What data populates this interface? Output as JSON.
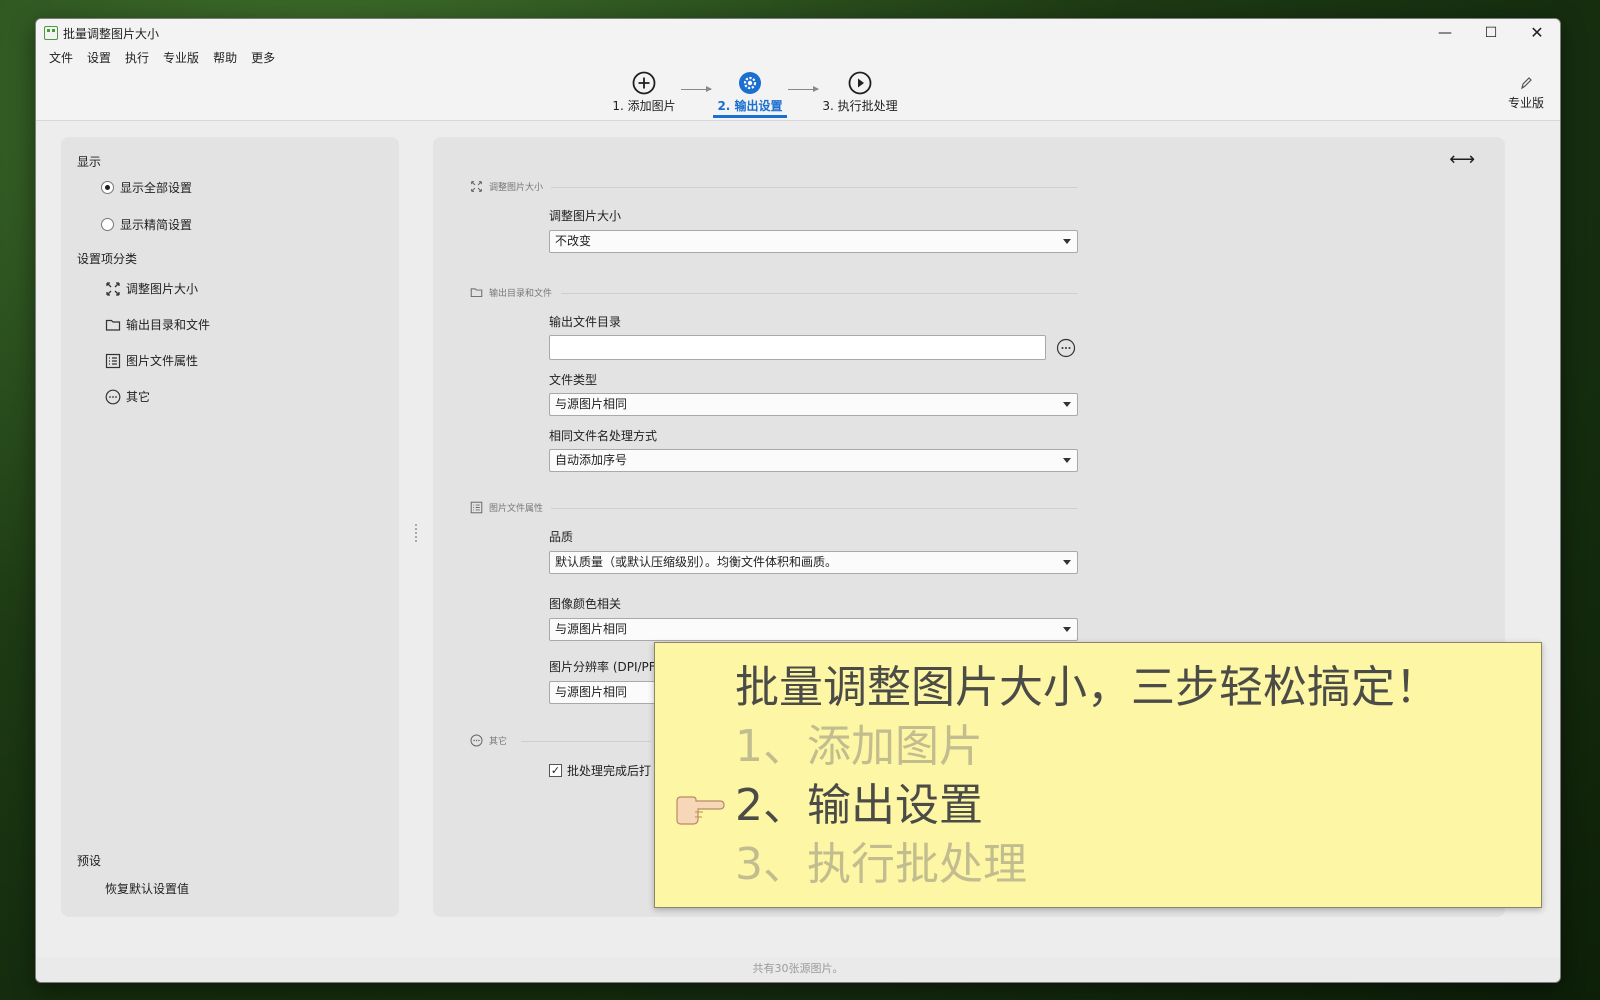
{
  "window": {
    "title": "批量调整图片大小"
  },
  "menu": [
    "文件",
    "设置",
    "执行",
    "专业版",
    "帮助",
    "更多"
  ],
  "steps": [
    {
      "label": "1. 添加图片",
      "icon": "plus-circle-icon"
    },
    {
      "label": "2. 输出设置",
      "icon": "gear-circle-icon",
      "active": true
    },
    {
      "label": "3. 执行批处理",
      "icon": "play-circle-icon"
    }
  ],
  "pro_button": {
    "label": "专业版",
    "icon": "pen-icon"
  },
  "sidebar": {
    "display_title": "显示",
    "radio_all": "显示全部设置",
    "radio_simple": "显示精简设置",
    "category_title": "设置项分类",
    "categories": [
      {
        "label": "调整图片大小",
        "icon": "resize-icon"
      },
      {
        "label": "输出目录和文件",
        "icon": "folder-icon"
      },
      {
        "label": "图片文件属性",
        "icon": "list-icon"
      },
      {
        "label": "其它",
        "icon": "more-circle-icon"
      }
    ],
    "preset_title": "预设",
    "restore_default": "恢复默认设置值"
  },
  "main": {
    "group_resize": "调整图片大小",
    "resize_label": "调整图片大小",
    "resize_value": "不改变",
    "group_output": "输出目录和文件",
    "output_dir_label": "输出文件目录",
    "output_dir_value": "",
    "file_type_label": "文件类型",
    "file_type_value": "与源图片相同",
    "same_name_label": "相同文件名处理方式",
    "same_name_value": "自动添加序号",
    "group_props": "图片文件属性",
    "quality_label": "品质",
    "quality_value": "默认质量（或默认压缩级别）。均衡文件体积和画质。",
    "color_label": "图像颜色相关",
    "color_value": "与源图片相同",
    "dpi_label": "图片分辨率 (DPI/PF",
    "dpi_value": "与源图片相同",
    "group_other": "其它",
    "open_after_label": "批处理完成后打",
    "open_after_checked": true
  },
  "status": "共有30张源图片。",
  "overlay": {
    "title": "批量调整图片大小，三步轻松搞定！",
    "line1": "1、添加图片",
    "line2": "2、输出设置",
    "line3": "3、执行批处理",
    "pointer_icon": "pointing-hand-icon"
  },
  "colors": {
    "accent": "#1a6fd1",
    "overlay_bg": "#fdf6a5"
  }
}
